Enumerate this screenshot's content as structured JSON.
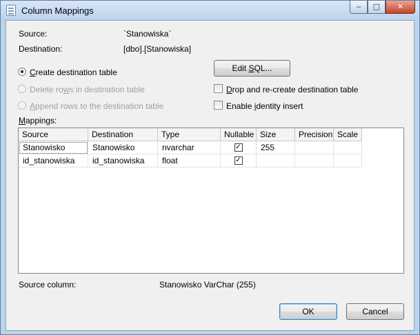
{
  "window": {
    "title": "Column Mappings",
    "caption_buttons": {
      "minimize": "‒",
      "maximize": "□",
      "close": "✕"
    }
  },
  "info": {
    "source_label": "Source:",
    "source_value": "`Stanowiska`",
    "destination_label": "Destination:",
    "destination_value": "[dbo].[Stanowiska]"
  },
  "options": {
    "create_table": {
      "pre": "",
      "accel": "C",
      "post": "reate destination table",
      "selected": true,
      "enabled": true
    },
    "delete_rows": {
      "pre": "Delete ro",
      "accel": "w",
      "post": "s in destination table",
      "selected": false,
      "enabled": false
    },
    "append_rows": {
      "pre": "",
      "accel": "A",
      "post": "ppend rows to the destination table",
      "selected": false,
      "enabled": false
    }
  },
  "edit_sql": {
    "pre": "Edit ",
    "accel": "S",
    "post": "QL..."
  },
  "checkboxes": {
    "drop_recreate": {
      "pre": "",
      "accel": "D",
      "post": "rop and re-create destination table",
      "checked": false
    },
    "identity_insert": {
      "pre": "Enable ",
      "accel": "i",
      "post": "dentity insert",
      "checked": false
    }
  },
  "mappings": {
    "label_accel": "M",
    "label_rest": "appings:",
    "columns": [
      "Source",
      "Destination",
      "Type",
      "Nullable",
      "Size",
      "Precision",
      "Scale"
    ],
    "rows": [
      {
        "source": "Stanowisko",
        "destination": "Stanowisko",
        "type": "nvarchar",
        "nullable": true,
        "size": "255",
        "precision": "",
        "scale": ""
      },
      {
        "source": "id_stanowiska",
        "destination": "id_stanowiska",
        "type": "float",
        "nullable": true,
        "size": "",
        "precision": "",
        "scale": ""
      }
    ]
  },
  "source_column": {
    "label": "Source column:",
    "value": "Stanowisko VarChar (255)"
  },
  "buttons": {
    "ok": "OK",
    "cancel": "Cancel"
  }
}
